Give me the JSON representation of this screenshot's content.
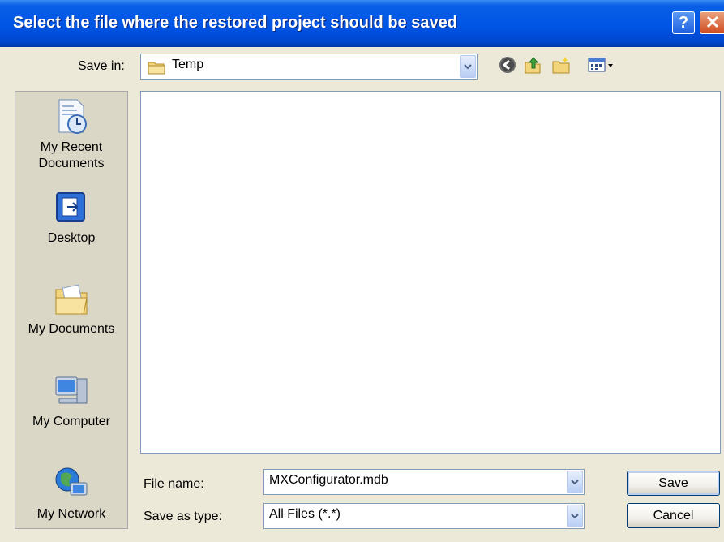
{
  "window": {
    "title": "Select the file where the restored project should be saved",
    "help_glyph": "?",
    "close_glyph": "✕"
  },
  "toolbar": {
    "save_in_label": "Save in:",
    "save_in_value": "Temp",
    "icons": [
      "back-icon",
      "up-folder-icon",
      "new-folder-icon",
      "views-menu-icon"
    ]
  },
  "places": [
    {
      "label": "My Recent Documents",
      "icon": "recent-documents-icon"
    },
    {
      "label": "Desktop",
      "icon": "desktop-icon"
    },
    {
      "label": "My Documents",
      "icon": "my-documents-icon"
    },
    {
      "label": "My Computer",
      "icon": "my-computer-icon"
    },
    {
      "label": "My Network",
      "icon": "my-network-icon"
    }
  ],
  "form": {
    "file_name_label": "File name:",
    "file_name_value": "MXConfigurator.mdb",
    "save_as_type_label": "Save as type:",
    "save_as_type_value": "All Files (*.*)"
  },
  "buttons": {
    "save": "Save",
    "cancel": "Cancel"
  },
  "colors": {
    "titlebar": "#0055E5",
    "dialog_bg": "#ECE9D8",
    "places_bg": "#DBD7C6"
  }
}
